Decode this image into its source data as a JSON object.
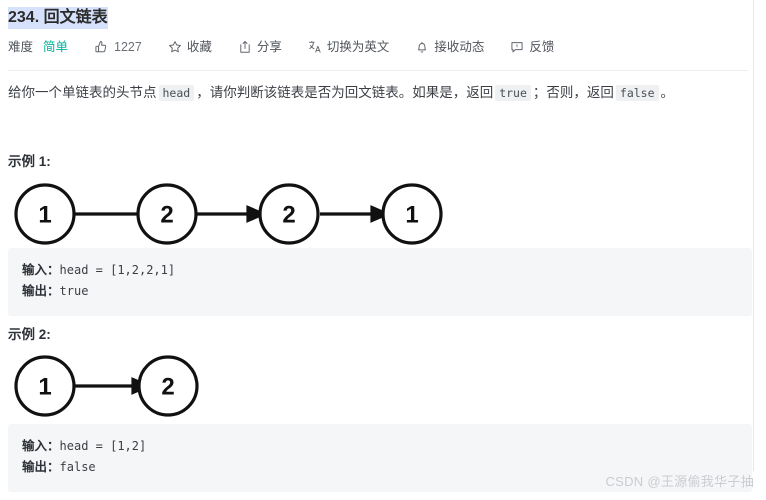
{
  "problem": {
    "title": "234. 回文链表",
    "difficulty_label": "难度",
    "difficulty_value": "简单",
    "accent_difficulty_color": "#00af9b",
    "title_highlight_color": "#d6e2fb"
  },
  "toolbar": {
    "like_count": "1227",
    "favorite_label": "收藏",
    "share_label": "分享",
    "translate_label": "切换为英文",
    "subscribe_label": "接收动态",
    "feedback_label": "反馈",
    "icons": {
      "like": "thumbs-up-icon",
      "favorite": "star-icon",
      "share": "share-icon",
      "translate": "translate-icon",
      "subscribe": "bell-icon",
      "feedback": "feedback-icon"
    }
  },
  "description": {
    "part1": "给你一个单链表的头节点",
    "code1": "head",
    "part2": "，请你判断该链表是否为回文链表。如果是，返回",
    "code2": "true",
    "part3": "；否则，返回",
    "code3": "false",
    "part4": "。"
  },
  "examples": [
    {
      "title": "示例 1:",
      "diagram": {
        "nodes": [
          "1",
          "2",
          "2",
          "1"
        ],
        "arrows": 3
      },
      "input_label": "输入：",
      "input_value": "head = [1,2,2,1]",
      "output_label": "输出：",
      "output_value": "true"
    },
    {
      "title": "示例 2:",
      "diagram": {
        "nodes": [
          "1",
          "2"
        ],
        "arrows": 1
      },
      "input_label": "输入：",
      "input_value": "head = [1,2]",
      "output_label": "输出：",
      "output_value": "false"
    }
  ],
  "watermark": "CSDN @王源偷我华子抽"
}
